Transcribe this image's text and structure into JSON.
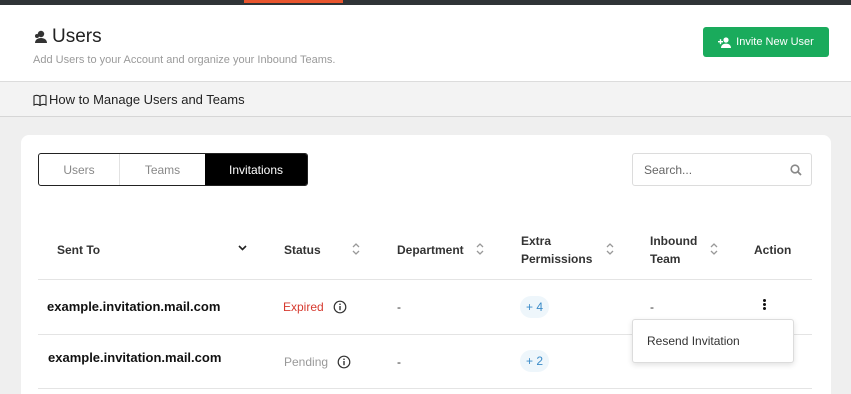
{
  "header": {
    "title": "Users",
    "subtitle": "Add Users to your Account and organize your Inbound Teams.",
    "invite_button": "Invite New User",
    "brand_color": "#1aab5c"
  },
  "howto": {
    "label": "How to Manage Users and Teams"
  },
  "tabs": [
    {
      "label": "Users",
      "active": false
    },
    {
      "label": "Teams",
      "active": false
    },
    {
      "label": "Invitations",
      "active": true
    }
  ],
  "search": {
    "placeholder": "Search...",
    "value": ""
  },
  "table": {
    "columns": [
      {
        "label": "Sent To"
      },
      {
        "label": "Status"
      },
      {
        "label": "Department"
      },
      {
        "label": "Extra",
        "label2": "Permissions"
      },
      {
        "label": "Inbound",
        "label2": "Team"
      },
      {
        "label": "Action"
      }
    ],
    "rows": [
      {
        "sent_to": "example.invitation.mail.com",
        "status": "Expired",
        "department": "-",
        "extra_permissions": "+ 4",
        "inbound_team": "-"
      },
      {
        "sent_to": "example.invitation.mail.com",
        "status": "Pending",
        "department": "-",
        "extra_permissions": "+ 2",
        "inbound_team": ""
      }
    ]
  },
  "action_menu": {
    "items": [
      {
        "label": "Resend Invitation"
      }
    ]
  },
  "colors": {
    "expired": "#d63a2f",
    "pending": "#999999",
    "badge_text": "#3b8bc8"
  }
}
